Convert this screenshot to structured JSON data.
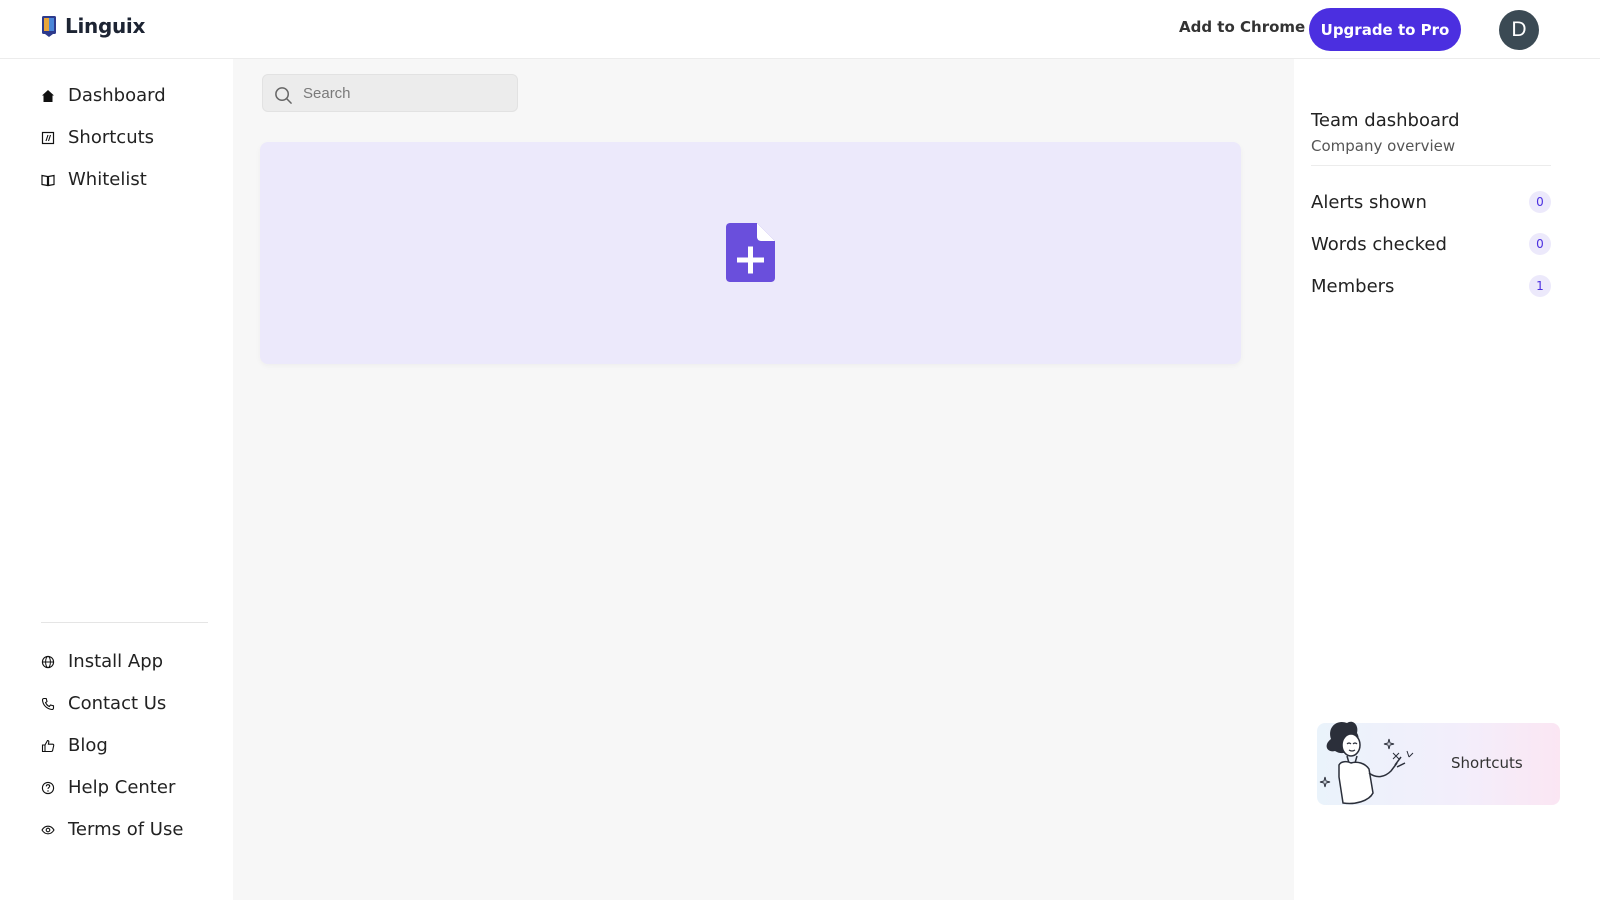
{
  "header": {
    "logo_text": "Linguix",
    "add_to_chrome": "Add to Chrome",
    "upgrade_label": "Upgrade to Pro",
    "avatar_initial": "D"
  },
  "sidebar": {
    "items": [
      {
        "label": "Dashboard",
        "icon": "home-icon"
      },
      {
        "label": "Shortcuts",
        "icon": "shortcuts-icon"
      },
      {
        "label": "Whitelist",
        "icon": "book-icon"
      }
    ],
    "footer_items": [
      {
        "label": "Install App",
        "icon": "globe-icon"
      },
      {
        "label": "Contact Us",
        "icon": "phone-icon"
      },
      {
        "label": "Blog",
        "icon": "thumbs-up-icon"
      },
      {
        "label": "Help Center",
        "icon": "question-circle-icon"
      },
      {
        "label": "Terms of Use",
        "icon": "eye-icon"
      }
    ]
  },
  "main": {
    "search": {
      "placeholder": "Search",
      "value": ""
    },
    "new_document_icon": "file-plus-icon"
  },
  "right_panel": {
    "title": "Team dashboard",
    "subtitle": "Company overview",
    "stats": [
      {
        "label": "Alerts shown",
        "value": "0"
      },
      {
        "label": "Words checked",
        "value": "0"
      },
      {
        "label": "Members",
        "value": "1"
      }
    ],
    "shortcuts_card_label": "Shortcuts"
  },
  "colors": {
    "accent": "#4b2fe0",
    "card_bg": "#ece9fb",
    "doc_icon": "#6a4fdc",
    "main_bg": "#f7f7f7"
  }
}
